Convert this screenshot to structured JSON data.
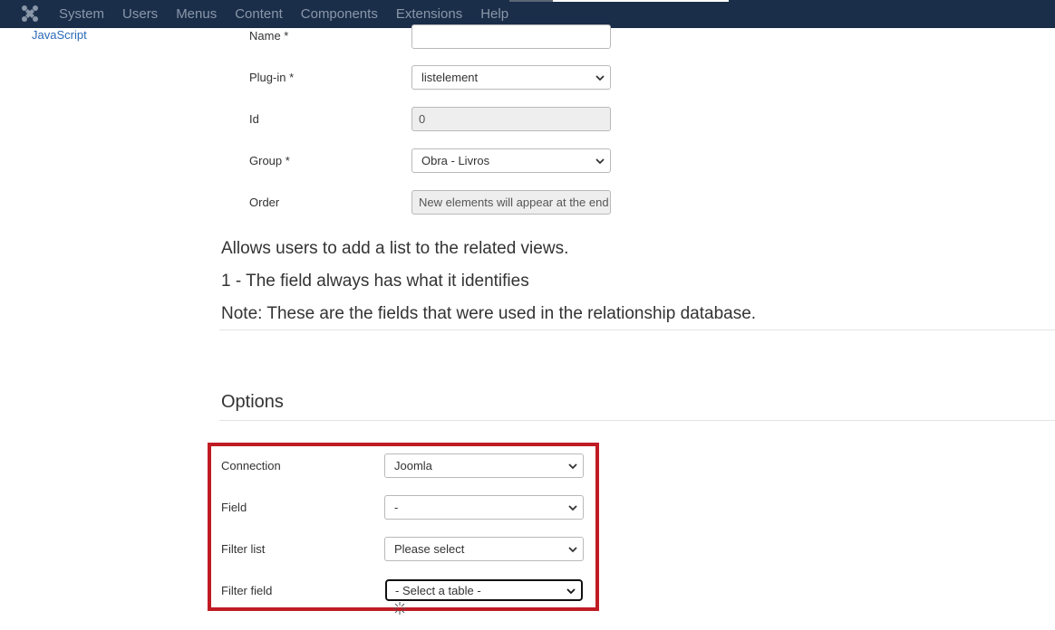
{
  "navbar": {
    "items": [
      "System",
      "Users",
      "Menus",
      "Content",
      "Components",
      "Extensions",
      "Help"
    ]
  },
  "sidebar": {
    "link": "JavaScript"
  },
  "details": {
    "name_label": "Name *",
    "name_value": "",
    "plugin_label": "Plug-in *",
    "plugin_value": "listelement",
    "id_label": "Id",
    "id_value": "0",
    "group_label": "Group *",
    "group_value": "Obra - Livros",
    "order_label": "Order",
    "order_value": "New elements will appear at the end"
  },
  "description": {
    "line1": "Allows users to add a list to the related views.",
    "line2": "1 - The field always has what it identifies",
    "line3": "Note: These are the fields that were used in the relationship database."
  },
  "options": {
    "title": "Options",
    "connection_label": "Connection",
    "connection_value": "Joomla",
    "field_label": "Field",
    "field_value": "-",
    "filter_list_label": "Filter list",
    "filter_list_value": "Please select",
    "filter_field_label": "Filter field",
    "filter_field_value": "- Select a table -"
  },
  "colors": {
    "navbar": "#1a2e4a",
    "highlight": "#c01b24",
    "link": "#2a69b8"
  }
}
